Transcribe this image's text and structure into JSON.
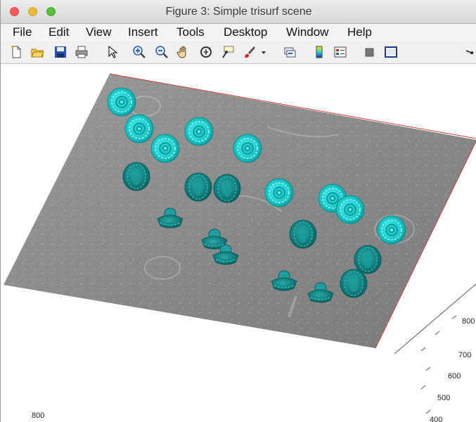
{
  "window": {
    "title": "Figure 3: Simple trisurf scene"
  },
  "menu": [
    "File",
    "Edit",
    "View",
    "Insert",
    "Tools",
    "Desktop",
    "Window",
    "Help"
  ],
  "toolbar": [
    {
      "name": "new-figure-icon"
    },
    {
      "name": "open-file-icon"
    },
    {
      "name": "save-icon"
    },
    {
      "name": "print-icon"
    },
    {
      "name": "edit-plot-arrow-icon"
    },
    {
      "name": "zoom-in-icon"
    },
    {
      "name": "zoom-out-icon"
    },
    {
      "name": "pan-hand-icon"
    },
    {
      "name": "rotate-3d-icon"
    },
    {
      "name": "data-cursor-icon"
    },
    {
      "name": "brush-icon"
    },
    {
      "name": "brush-dropdown-icon"
    },
    {
      "name": "link-plot-icon"
    },
    {
      "name": "colorbar-icon"
    },
    {
      "name": "legend-icon"
    },
    {
      "name": "hide-plot-tools-icon"
    },
    {
      "name": "show-plot-tools-icon"
    },
    {
      "name": "dock-arrow-icon"
    }
  ],
  "axes": {
    "right_ticks": [
      "800",
      "700",
      "600",
      "500",
      "400"
    ],
    "bottom_ticks": [
      "800"
    ]
  },
  "colors": {
    "mesh": "#19c7c7",
    "mesh_dark": "#0f8a8a",
    "plane": "#8e8e8e",
    "plane_edge": "#cc2b2b"
  }
}
